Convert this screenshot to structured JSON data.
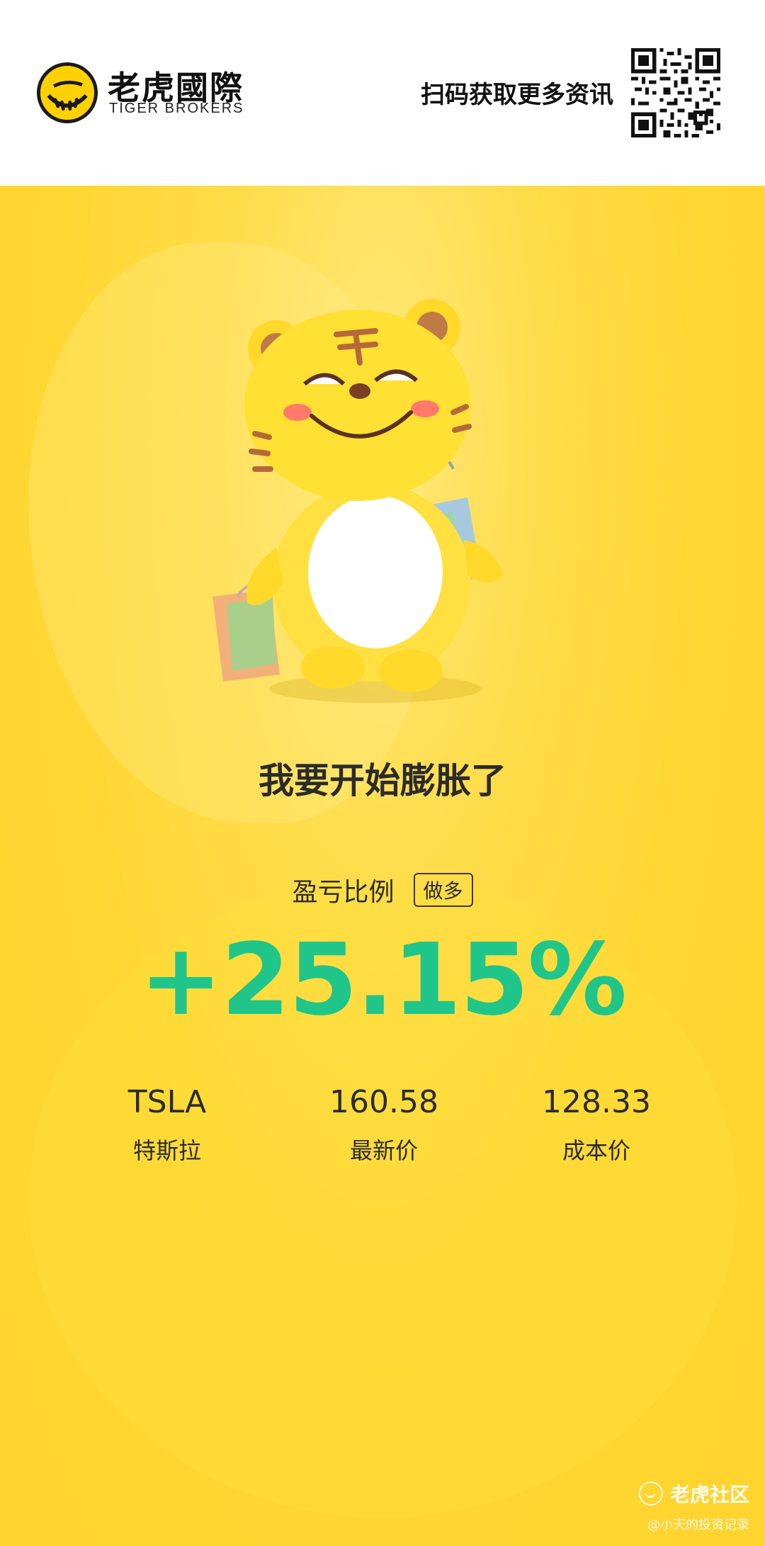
{
  "header": {
    "brand_cn": "老虎國際",
    "brand_en": "TIGER BROKERS",
    "scan_text": "扫码获取更多资讯",
    "logo_icon": "tiger-logo-icon",
    "qr_icon": "qr-code-icon"
  },
  "card": {
    "headline": "我要开始膨胀了",
    "ratio_label": "盈亏比例",
    "ratio_badge": "做多",
    "percent": "+25.15%",
    "stats": [
      {
        "value": "TSLA",
        "label": "特斯拉"
      },
      {
        "value": "160.58",
        "label": "最新价"
      },
      {
        "value": "128.33",
        "label": "成本价"
      }
    ]
  },
  "watermark": {
    "title": "老虎社区",
    "sub": "@小天的投资记录"
  },
  "colors": {
    "accent_green": "#20c58a",
    "background_yellow": "#ffd632",
    "text_dark": "#2b2b2b"
  }
}
